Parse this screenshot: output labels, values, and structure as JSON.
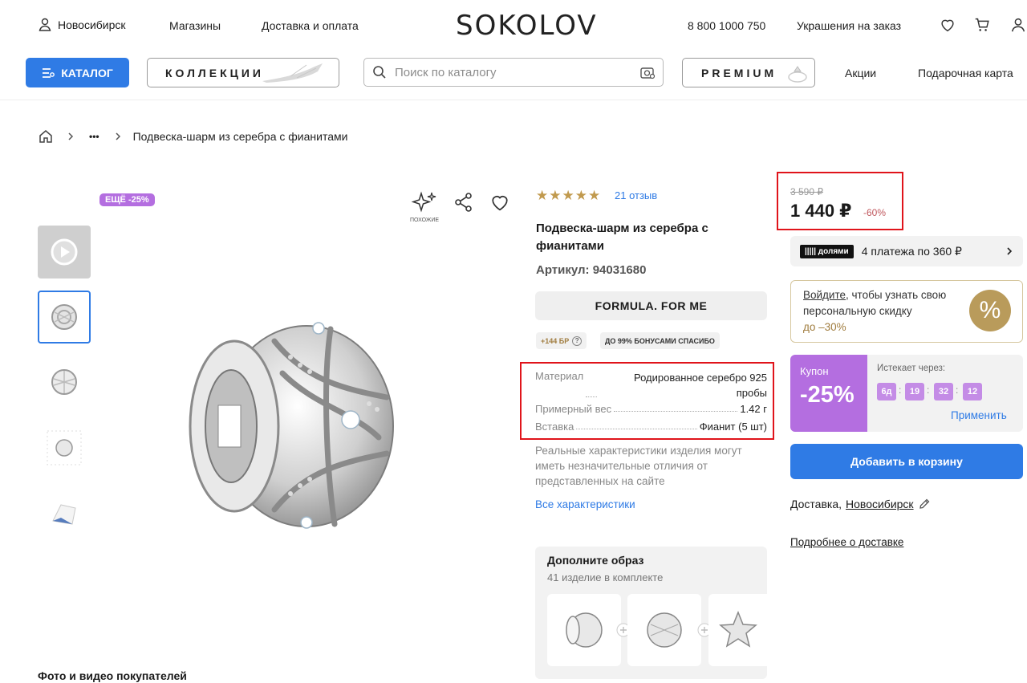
{
  "header": {
    "city": "Новосибирск",
    "shops": "Магазины",
    "delivery_payment": "Доставка и оплата",
    "logo": "SOKOLOV",
    "phone": "8 800 1000 750",
    "custom_jewelry": "Украшения на заказ",
    "catalog_label": "КАТАЛОГ",
    "collections_label": "КОЛЛЕКЦИИ",
    "search_placeholder": "Поиск по каталогу",
    "premium_label": "PREMIUM",
    "promos": "Акции",
    "gift_card": "Подарочная карта"
  },
  "breadcrumb": {
    "ellipsis": "•••",
    "current": "Подвеска-шарм из серебра с фианитами"
  },
  "gallery": {
    "badge": "ЕЩЁ -25%",
    "similar_label": "ПОХОЖИЕ"
  },
  "product": {
    "stars": "★★★★★",
    "reviews": "21 отзыв",
    "title": "Подвеска-шарм из серебра с фианитами",
    "sku": "Артикул: 94031680",
    "collection": "FORMULA. FOR ME",
    "bonus_pill": "+144 БР",
    "bonus_help": "?",
    "spasibo_pill": "ДО 99% БОНУСАМИ СПАСИБО",
    "specs": [
      {
        "label": "Материал",
        "value_line1": "Родированное серебро 925",
        "value_line2": "пробы"
      },
      {
        "label": "Примерный вес",
        "value": "1.42 г"
      },
      {
        "label": "Вставка",
        "value": "Фианит (5 шт)"
      }
    ],
    "disclaimer": "Реальные характеристики изделия могут иметь незначительные отличия от представленных на сайте",
    "all_specs": "Все характеристики"
  },
  "complete_look": {
    "title": "Дополните образ",
    "subtitle": "41 изделие в комплекте"
  },
  "pricing": {
    "old_price": "3 590 ₽",
    "price": "1 440 ₽",
    "discount": "-60%",
    "dolyami_logo": "||||| долями",
    "installments": "4 платежа по 360 ₽",
    "login_link": "Войдите",
    "personal_text": ", чтобы узнать свою персональную скидку",
    "personal_upto": "до –30%",
    "percent_symbol": "%",
    "coupon_label": "Купон",
    "coupon_value": "-25%",
    "expires_label": "Истекает через:",
    "timer": [
      "6д",
      "19",
      "32",
      "12"
    ],
    "apply": "Применить",
    "add_to_cart": "Добавить в корзину",
    "delivery_label": "Доставка,",
    "delivery_city": "Новосибирск",
    "delivery_more": "Подробнее о доставке"
  },
  "customer_photos_title": "Фото и видео покупателей",
  "colors": {
    "accent_blue": "#2f7be5",
    "coupon_purple": "#b46ee0",
    "gold": "#c19a4e",
    "highlight_red": "#e0141b"
  }
}
